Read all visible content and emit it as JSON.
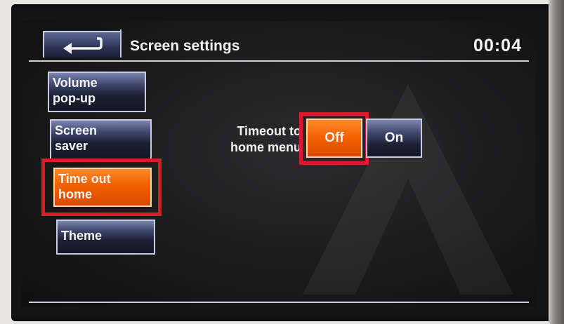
{
  "header": {
    "back_icon": "back-arrow-icon",
    "title": "Screen settings",
    "clock": "00:04"
  },
  "menu": {
    "items": [
      {
        "line1": "Volume",
        "line2": "pop-up",
        "active": false
      },
      {
        "line1": "Screen",
        "line2": "saver",
        "active": false
      },
      {
        "line1": "Time out",
        "line2": "home",
        "active": true
      },
      {
        "line1": "Theme",
        "line2": "",
        "active": false
      }
    ]
  },
  "setting": {
    "label_line1": "Timeout to",
    "label_line2": "home menu",
    "options": [
      {
        "label": "Off",
        "selected": true
      },
      {
        "label": "On",
        "selected": false
      }
    ]
  },
  "colors": {
    "accent_orange": "#f36400",
    "button_blue": "#3f476d",
    "highlight_red": "#d91c2a"
  }
}
